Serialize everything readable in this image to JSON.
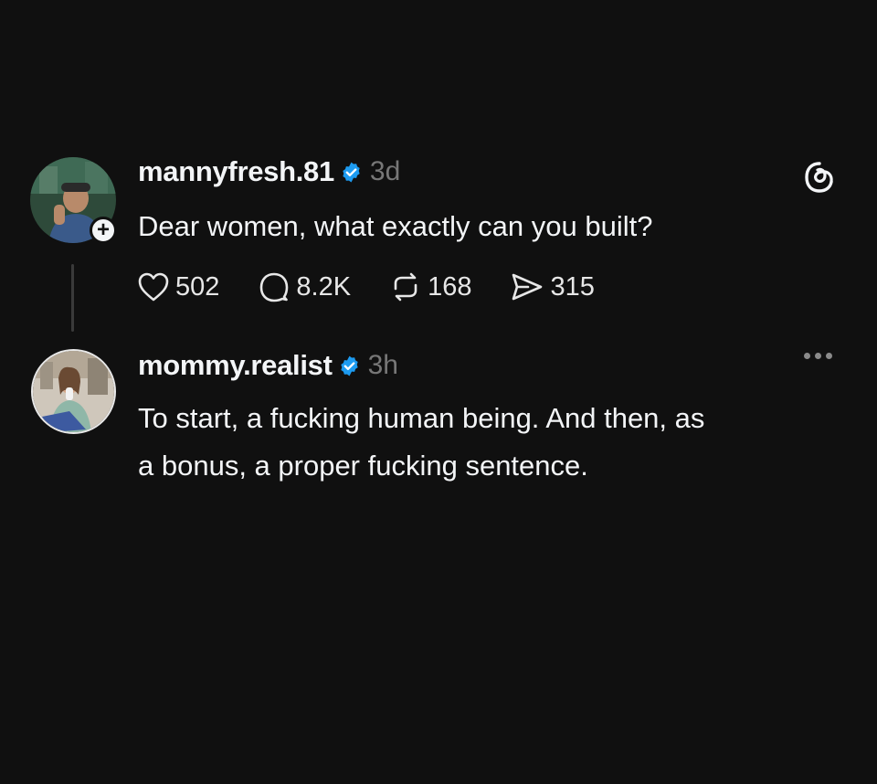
{
  "posts": [
    {
      "username": "mannyfresh.81",
      "time": "3d",
      "text": "Dear women, what exactly can you built?",
      "likes": "502",
      "replies": "8.2K",
      "reposts": "168",
      "shares": "315",
      "avatar": "avatar-photo"
    },
    {
      "username": "mommy.realist",
      "time": "3h",
      "text_lines": [
        "To start, a fucking human being. And then, as",
        "a bonus, a proper fucking sentence."
      ],
      "avatar": "avatar-photo"
    }
  ],
  "colors": {
    "background": "#101010",
    "text": "#f3f5f7",
    "muted": "#777777",
    "verified": "#1d9bf0"
  },
  "icons": [
    "heart-icon",
    "comment-icon",
    "repost-icon",
    "share-icon",
    "threads-logo-icon",
    "more-icon",
    "verified-icon",
    "follow-plus-icon"
  ]
}
